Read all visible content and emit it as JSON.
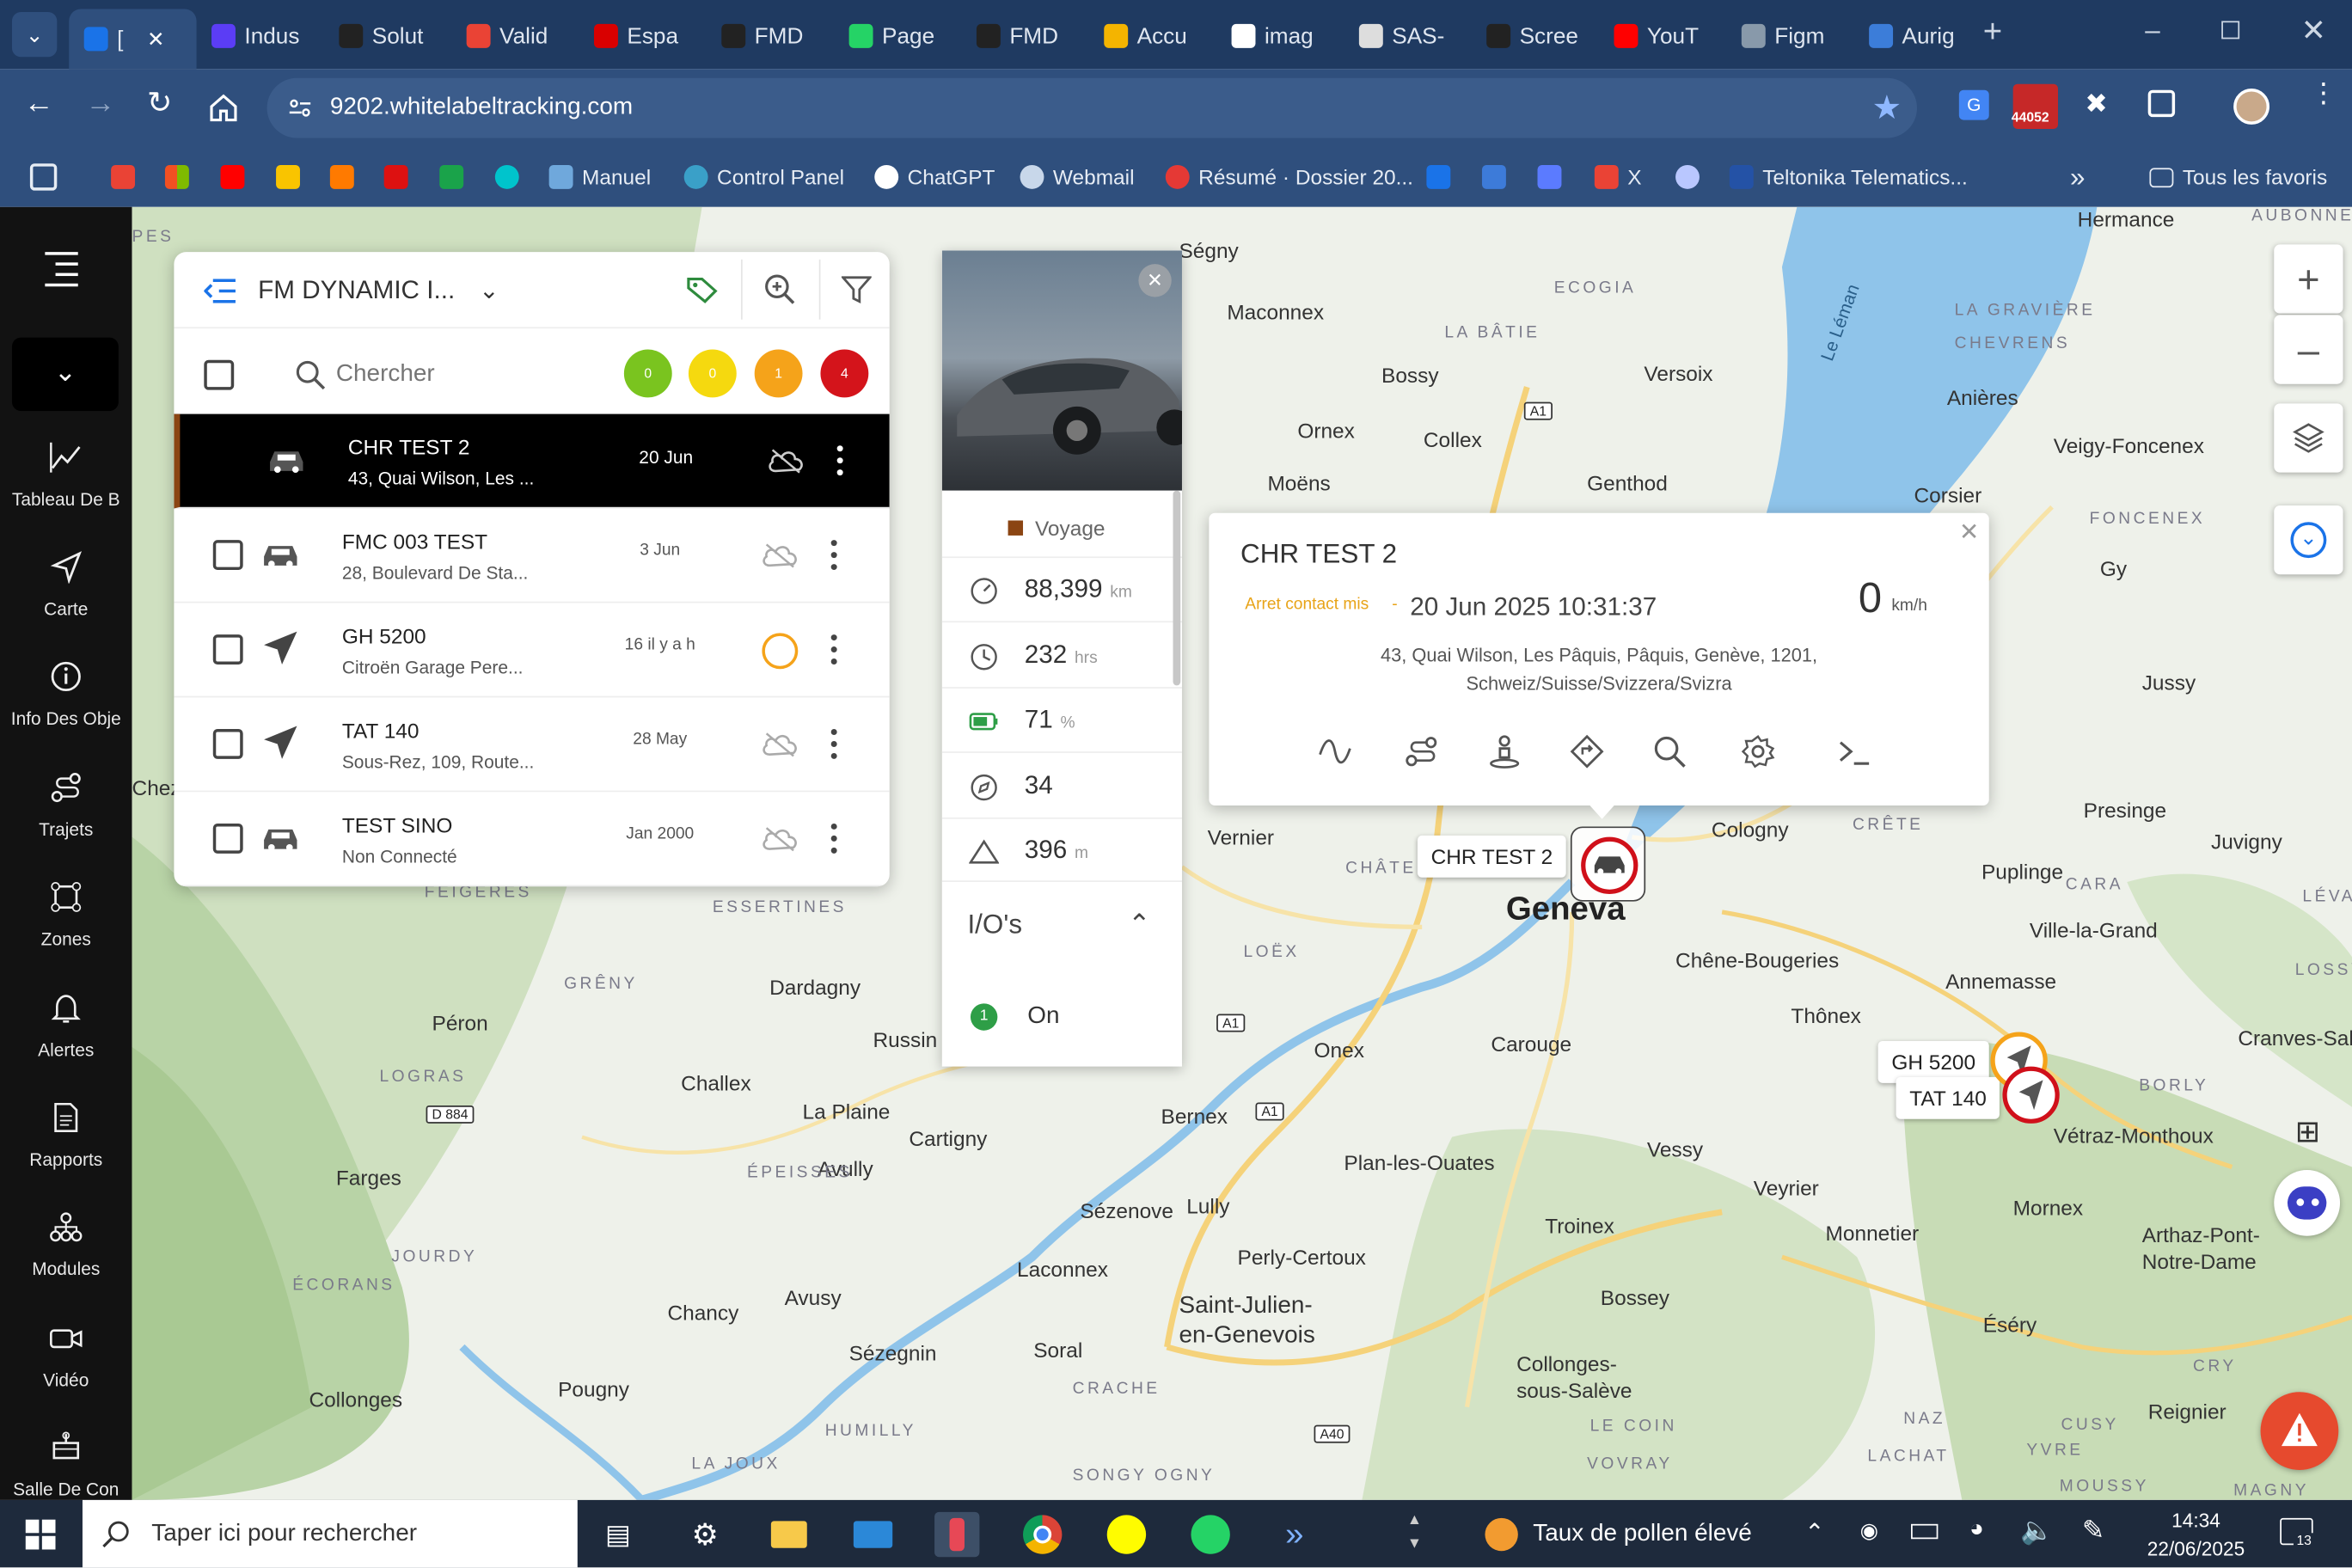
{
  "browser": {
    "tabs": [
      {
        "label": "[",
        "icon": "fm-icon",
        "color": "#1a73e8"
      },
      {
        "label": "Indus",
        "icon": "indus-icon",
        "color": "#5b3df5"
      },
      {
        "label": "Solut",
        "icon": "openai-icon",
        "color": "#222222"
      },
      {
        "label": "Valid",
        "icon": "gmail-icon",
        "color": "#ea4335"
      },
      {
        "label": "Espa",
        "icon": "flash-icon",
        "color": "#d90000"
      },
      {
        "label": "FMD",
        "icon": "triangle-icon",
        "color": "#222222"
      },
      {
        "label": "Page",
        "icon": "whatsapp-icon",
        "color": "#25d366"
      },
      {
        "label": "FMD",
        "icon": "triangle-icon",
        "color": "#222222"
      },
      {
        "label": "Accu",
        "icon": "drive-icon",
        "color": "#f4b400"
      },
      {
        "label": "imag",
        "icon": "google-icon",
        "color": "#ffffff"
      },
      {
        "label": "SAS-",
        "icon": "sas-icon",
        "color": "#dddddd"
      },
      {
        "label": "Scree",
        "icon": "capcut-icon",
        "color": "#222222"
      },
      {
        "label": "YouT",
        "icon": "youtube-icon",
        "color": "#ff0000"
      },
      {
        "label": "Figm",
        "icon": "globe-icon",
        "color": "#8899aa"
      },
      {
        "label": "Aurig",
        "icon": "aurig-icon",
        "color": "#3c7dd9"
      }
    ],
    "url": "9202.whitelabeltracking.com",
    "extension_badge": "44052",
    "bookmarks": [
      {
        "label": "Manuel",
        "icon": "manuel-icon"
      },
      {
        "label": "Control Panel",
        "icon": "control-panel-icon"
      },
      {
        "label": "ChatGPT",
        "icon": "openai-icon"
      },
      {
        "label": "Webmail",
        "icon": "webmail-icon"
      },
      {
        "label": "Résumé · Dossier 20...",
        "icon": "resume-icon"
      },
      {
        "label": "X",
        "icon": "gmail-icon"
      },
      {
        "label": "Teltonika Telematics...",
        "icon": "teltonika-icon"
      }
    ],
    "all_bookmarks": "Tous les favoris"
  },
  "sidebar": {
    "items": [
      {
        "label": "Tableau De B",
        "icon": "chart-icon"
      },
      {
        "label": "Carte",
        "icon": "navigation-icon"
      },
      {
        "label": "Info Des Obje",
        "icon": "info-icon"
      },
      {
        "label": "Trajets",
        "icon": "route-icon"
      },
      {
        "label": "Zones",
        "icon": "zones-icon"
      },
      {
        "label": "Alertes",
        "icon": "bell-icon"
      },
      {
        "label": "Rapports",
        "icon": "report-icon"
      },
      {
        "label": "Modules",
        "icon": "modules-icon"
      },
      {
        "label": "Vidéo",
        "icon": "video-icon"
      },
      {
        "label": "Salle De Con",
        "icon": "control-room-icon"
      }
    ]
  },
  "panel": {
    "group_name": "FM DYNAMIC I...",
    "search_placeholder": "Chercher",
    "counts": [
      {
        "value": "0",
        "color": "#7ac41f"
      },
      {
        "value": "0",
        "color": "#f5d90f"
      },
      {
        "value": "1",
        "color": "#f5a31a"
      },
      {
        "value": "4",
        "color": "#d4141b"
      }
    ],
    "vehicles": [
      {
        "name": "CHR TEST 2",
        "address": "43, Quai Wilson, Les ...",
        "date": "20 Jun",
        "icon": "car-icon",
        "status": "cloud-icon",
        "selected": true
      },
      {
        "name": "FMC 003 TEST",
        "address": "28, Boulevard De Sta...",
        "date": "3 Jun",
        "icon": "car-icon",
        "status": "cloud-icon"
      },
      {
        "name": "GH 5200",
        "address": "Citroën Garage Pere...",
        "date": "16 il y a h",
        "icon": "arrow-icon",
        "status": "ring-icon"
      },
      {
        "name": "TAT 140",
        "address": "Sous-Rez, 109, Route...",
        "date": "28 May",
        "icon": "arrow-icon",
        "status": "cloud-icon"
      },
      {
        "name": "TEST SINO",
        "address": "Non Connecté",
        "date": "Jan 2000",
        "icon": "car-icon",
        "status": "cloud-icon"
      }
    ]
  },
  "detail": {
    "state": "Voyage",
    "stats": [
      {
        "value": "88,399",
        "unit": "km",
        "icon": "odometer-icon"
      },
      {
        "value": "232",
        "unit": "hrs",
        "icon": "clock-icon"
      },
      {
        "value": "71",
        "unit": "%",
        "icon": "battery-icon"
      },
      {
        "value": "34",
        "unit": "",
        "icon": "compass-icon"
      },
      {
        "value": "396",
        "unit": "m",
        "icon": "altitude-icon"
      }
    ],
    "io_title": "I/O's",
    "io_items": [
      {
        "index": "1",
        "value": "On"
      }
    ]
  },
  "popup": {
    "title": "CHR TEST 2",
    "status": "Arret contact mis",
    "separator": "-",
    "datetime": "20 Jun 2025 10:31:37",
    "speed": "0",
    "speed_unit": "km/h",
    "address_line1": "43, Quai Wilson, Les Pâquis, Pâquis, Genève, 1201,",
    "address_line2": "Schweiz/Suisse/Svizzera/Svizra"
  },
  "map": {
    "markers": [
      {
        "label": "CHR TEST 2"
      },
      {
        "label": "GH 5200"
      },
      {
        "label": "TAT 140"
      }
    ],
    "places": [
      "Ségny",
      "Maconnex",
      "Bossy",
      "Versoix",
      "Ornex",
      "Collex",
      "Moëns",
      "Genthod",
      "Vernier",
      "Geneva",
      "Cologny",
      "Chêne-Bougeries",
      "Annemasse",
      "Thônex",
      "Carouge",
      "Onex",
      "Bernex",
      "Plan-les-Ouates",
      "Vessy",
      "Veyrier",
      "Troinex",
      "Perly-Certoux",
      "Saint-Julien-en-Genevois",
      "Laconnex",
      "Soral",
      "Sézenove",
      "Lully",
      "Avully",
      "Cartigny",
      "La Plaine",
      "Dardagny",
      "Russin",
      "Challex",
      "Péron",
      "Farges",
      "Chancy",
      "Avusy",
      "Sézegnin",
      "Collonges",
      "Pougny",
      "Collonges-sous-Salève",
      "Bossey",
      "Monnetier",
      "Mornex",
      "Éséry",
      "Reignier",
      "Arthaz-Pont-Notre-Dame",
      "Vétraz-Monthoux",
      "Cranves-Sales",
      "Ville-la-Grand",
      "Juvigny",
      "Presinge",
      "Puplinge",
      "Jussy",
      "Gy",
      "Corsier",
      "Anières",
      "Veigy-Foncenex",
      "Chez",
      "Le Léman",
      "Hermance"
    ],
    "areas": [
      "LA BÂTIE",
      "ECOGIA",
      "LA GRAVIÈRE",
      "CHEVRENS",
      "FONCENEX",
      "CRÊTE",
      "CARA",
      "LÉVA",
      "LOSSY",
      "BORLY",
      "CHÂTELAINE",
      "LOËX",
      "GRÊNY",
      "LOGRAS",
      "JOURDY",
      "ÉCORANS",
      "ÉPEISSES",
      "FEIGÈRES",
      "ESSERTINES",
      "CRACHE",
      "HUMILLY",
      "LA JOUX",
      "SONGY OGNY",
      "LE COIN",
      "VOVRAY",
      "NAZ",
      "LACHAT",
      "CUSY",
      "YVRE",
      "MOUSSY",
      "MAGNY",
      "CRY",
      "AUBONNE",
      "PES"
    ],
    "roads": [
      "A1",
      "A1",
      "A1",
      "D 884",
      "A40"
    ]
  },
  "taskbar": {
    "search_placeholder": "Taper ici pour rechercher",
    "weather": "Taux de pollen élevé",
    "time": "14:34",
    "date": "22/06/2025",
    "notifications": "13"
  }
}
